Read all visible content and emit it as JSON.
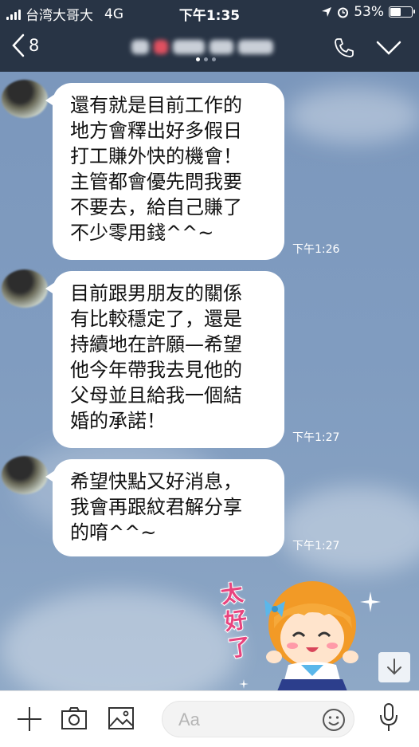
{
  "status_bar": {
    "carrier": "台湾大哥大",
    "network": "4G",
    "time": "下午1:35",
    "battery_percent": "53%",
    "battery_level": 0.53
  },
  "header": {
    "back_count": "8"
  },
  "messages": [
    {
      "text": "還有就是目前工作的\n地方會釋出好多假日\n打工賺外快的機會！\n主管都會優先問我要\n不要去，給自己賺了\n不少零用錢^^~",
      "time": "下午1:26"
    },
    {
      "text": "目前跟男朋友的關係\n有比較穩定了，還是\n持續地在許願—希望\n他今年帶我去見他的\n父母並且給我一個結\n婚的承諾！",
      "time": "下午1:27"
    },
    {
      "text": "希望快點又好消息，\n我會再跟紋君解分享\n的唷^^~",
      "time": "下午1:27"
    }
  ],
  "sticker": {
    "text": "太好了"
  },
  "input": {
    "placeholder": "Aa"
  },
  "colors": {
    "header_bg": "#283445",
    "chat_bg": "#7d99bd",
    "sticker_text": "#e8447e",
    "bubble": "#ffffff"
  }
}
